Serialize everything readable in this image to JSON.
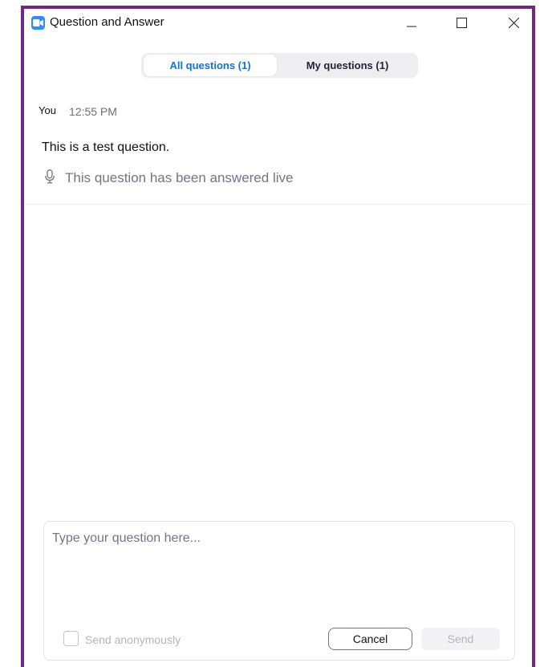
{
  "window": {
    "title": "Question and Answer",
    "accent": "#6e2a7f",
    "app_icon": "zoom-camera-icon",
    "controls": [
      "minimize-icon",
      "maximize-icon",
      "close-icon"
    ]
  },
  "tabs": [
    {
      "label": "All questions (1)",
      "active": true
    },
    {
      "label": "My questions (1)",
      "active": false
    }
  ],
  "question": {
    "author": "You",
    "time": "12:55 PM",
    "text": "This is a test question.",
    "status_icon": "microphone-icon",
    "status": "This question has been answered live"
  },
  "compose": {
    "placeholder": "Type your question here...",
    "anonymous_label": "Send anonymously",
    "anonymous_checked": false,
    "cancel_label": "Cancel",
    "send_label": "Send"
  },
  "colors": {
    "active_tab_text": "#0e71eb",
    "zoom_blue": "#2d8cff"
  }
}
